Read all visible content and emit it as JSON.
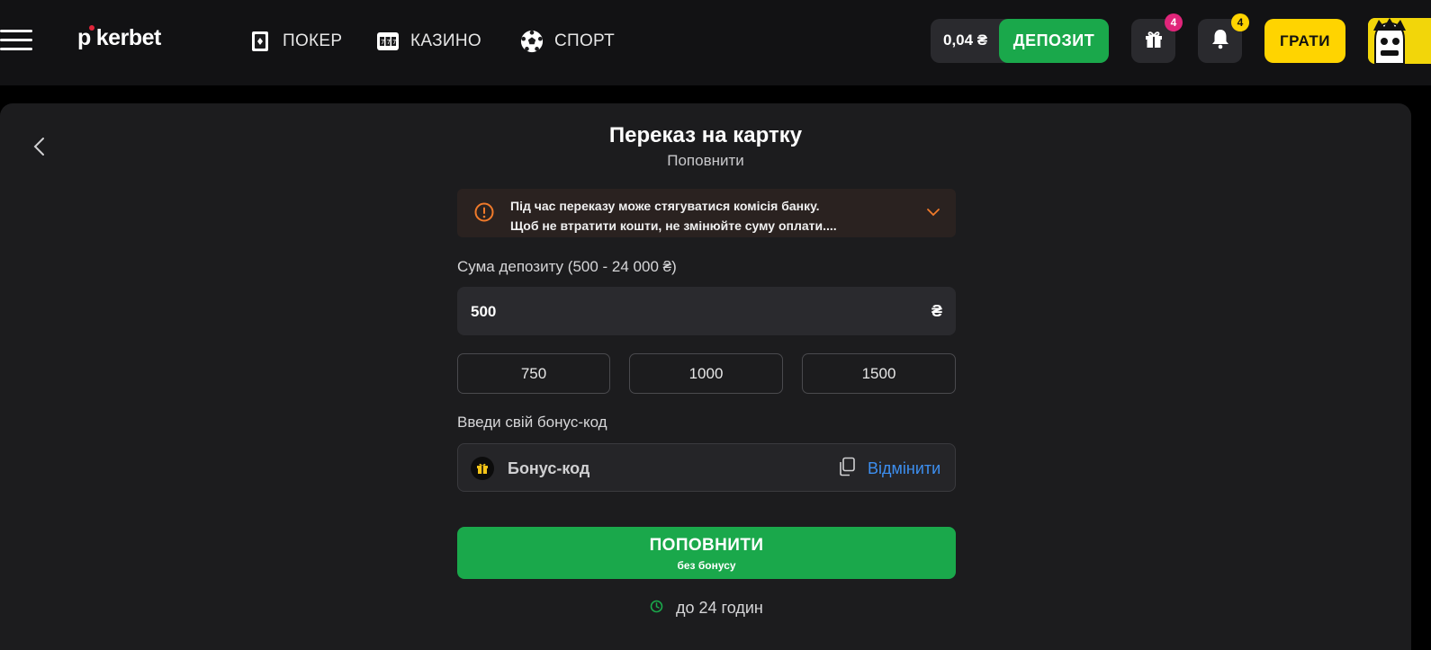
{
  "header": {
    "logo": {
      "part1": "p",
      "part2": "kerbet"
    },
    "nav": [
      {
        "label": "ПОКЕР",
        "icon": "poker-card-icon"
      },
      {
        "label": "КАЗИНО",
        "icon": "slot-machine-icon"
      },
      {
        "label": "СПОРТ",
        "icon": "soccer-ball-icon"
      }
    ],
    "balance": "0,04 ₴",
    "deposit_label": "ДЕПОЗИТ",
    "gift_badge": "4",
    "notification_badge": "4",
    "play_label": "ГРАТИ"
  },
  "panel": {
    "title": "Переказ на картку",
    "subtitle": "Поповнити",
    "warning": {
      "line1": "Під час переказу може стягуватися комісія банку.",
      "line2": "Щоб не втратити кошти, не змінюйте суму оплати...."
    },
    "amount_label": "Сума депозиту (500 - 24 000 ₴)",
    "amount_value": "500",
    "currency": "₴",
    "quick_amounts": [
      "750",
      "1000",
      "1500"
    ],
    "bonus_label": "Введи свій бонус-код",
    "bonus_placeholder": "Бонус-код",
    "bonus_cancel": "Відмінити",
    "submit_main": "ПОПОВНИТИ",
    "submit_sub": "без бонусу",
    "processing_time": "до 24 годин"
  },
  "colors": {
    "accent_green": "#1aa84b",
    "play_yellow": "#ffd400",
    "link_blue": "#3d8ff0",
    "warning_orange": "#f07a2a",
    "badge_pink": "#e0257a",
    "badge_yellow": "#ffd400"
  }
}
